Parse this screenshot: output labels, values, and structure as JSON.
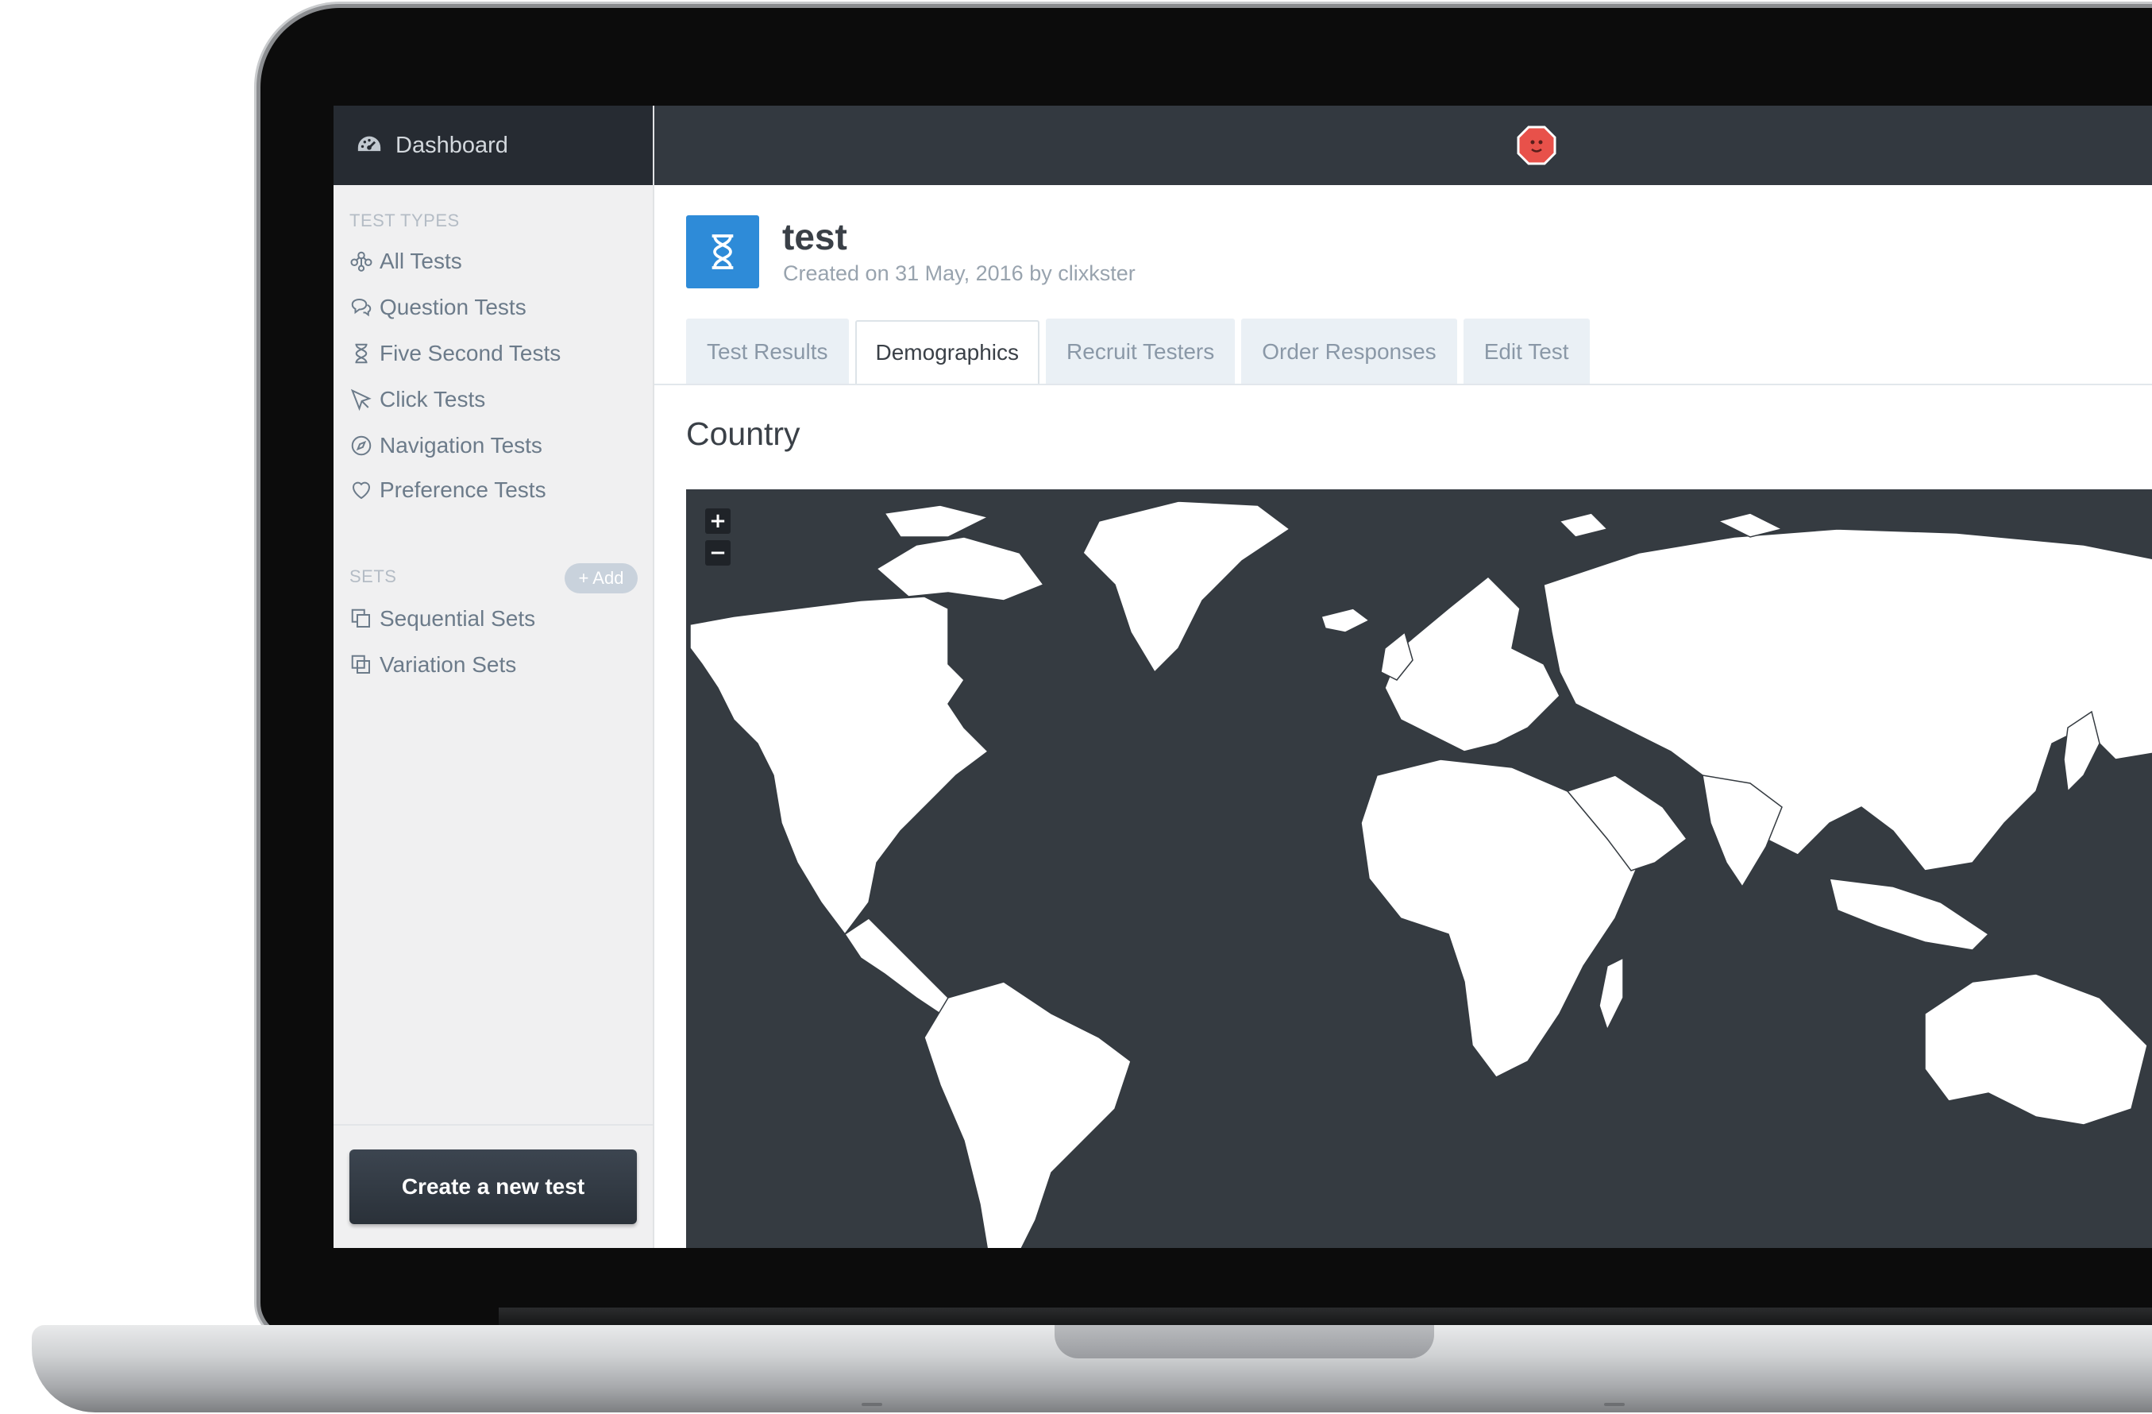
{
  "sidebar": {
    "header_label": "Dashboard",
    "test_types_label": "TEST TYPES",
    "test_types": [
      {
        "label": "All Tests",
        "icon": "nodes-icon"
      },
      {
        "label": "Question Tests",
        "icon": "chat-bubbles-icon"
      },
      {
        "label": "Five Second Tests",
        "icon": "hourglass-icon"
      },
      {
        "label": "Click Tests",
        "icon": "cursor-icon"
      },
      {
        "label": "Navigation Tests",
        "icon": "compass-icon"
      },
      {
        "label": "Preference Tests",
        "icon": "heart-icon"
      }
    ],
    "sets_label": "SETS",
    "add_label": "+ Add",
    "sets": [
      {
        "label": "Sequential Sets",
        "icon": "sequential-sets-icon"
      },
      {
        "label": "Variation Sets",
        "icon": "variation-sets-icon"
      }
    ],
    "create_button_label": "Create a new test"
  },
  "test": {
    "title": "test",
    "meta": "Created on 31 May, 2016 by clixkster",
    "icon": "hourglass-icon"
  },
  "tabs": [
    {
      "label": "Test Results",
      "active": false
    },
    {
      "label": "Demographics",
      "active": true
    },
    {
      "label": "Recruit Testers",
      "active": false
    },
    {
      "label": "Order Responses",
      "active": false
    },
    {
      "label": "Edit Test",
      "active": false
    }
  ],
  "section_title": "Country",
  "map": {
    "zoom_in_label": "+",
    "zoom_out_label": "−",
    "background_color": "#353b41",
    "land_color": "#ffffff"
  },
  "colors": {
    "accent": "#2e8bd8",
    "topbar": "#333940",
    "sidebar_header": "#262b32",
    "logo": "#e8514a"
  }
}
